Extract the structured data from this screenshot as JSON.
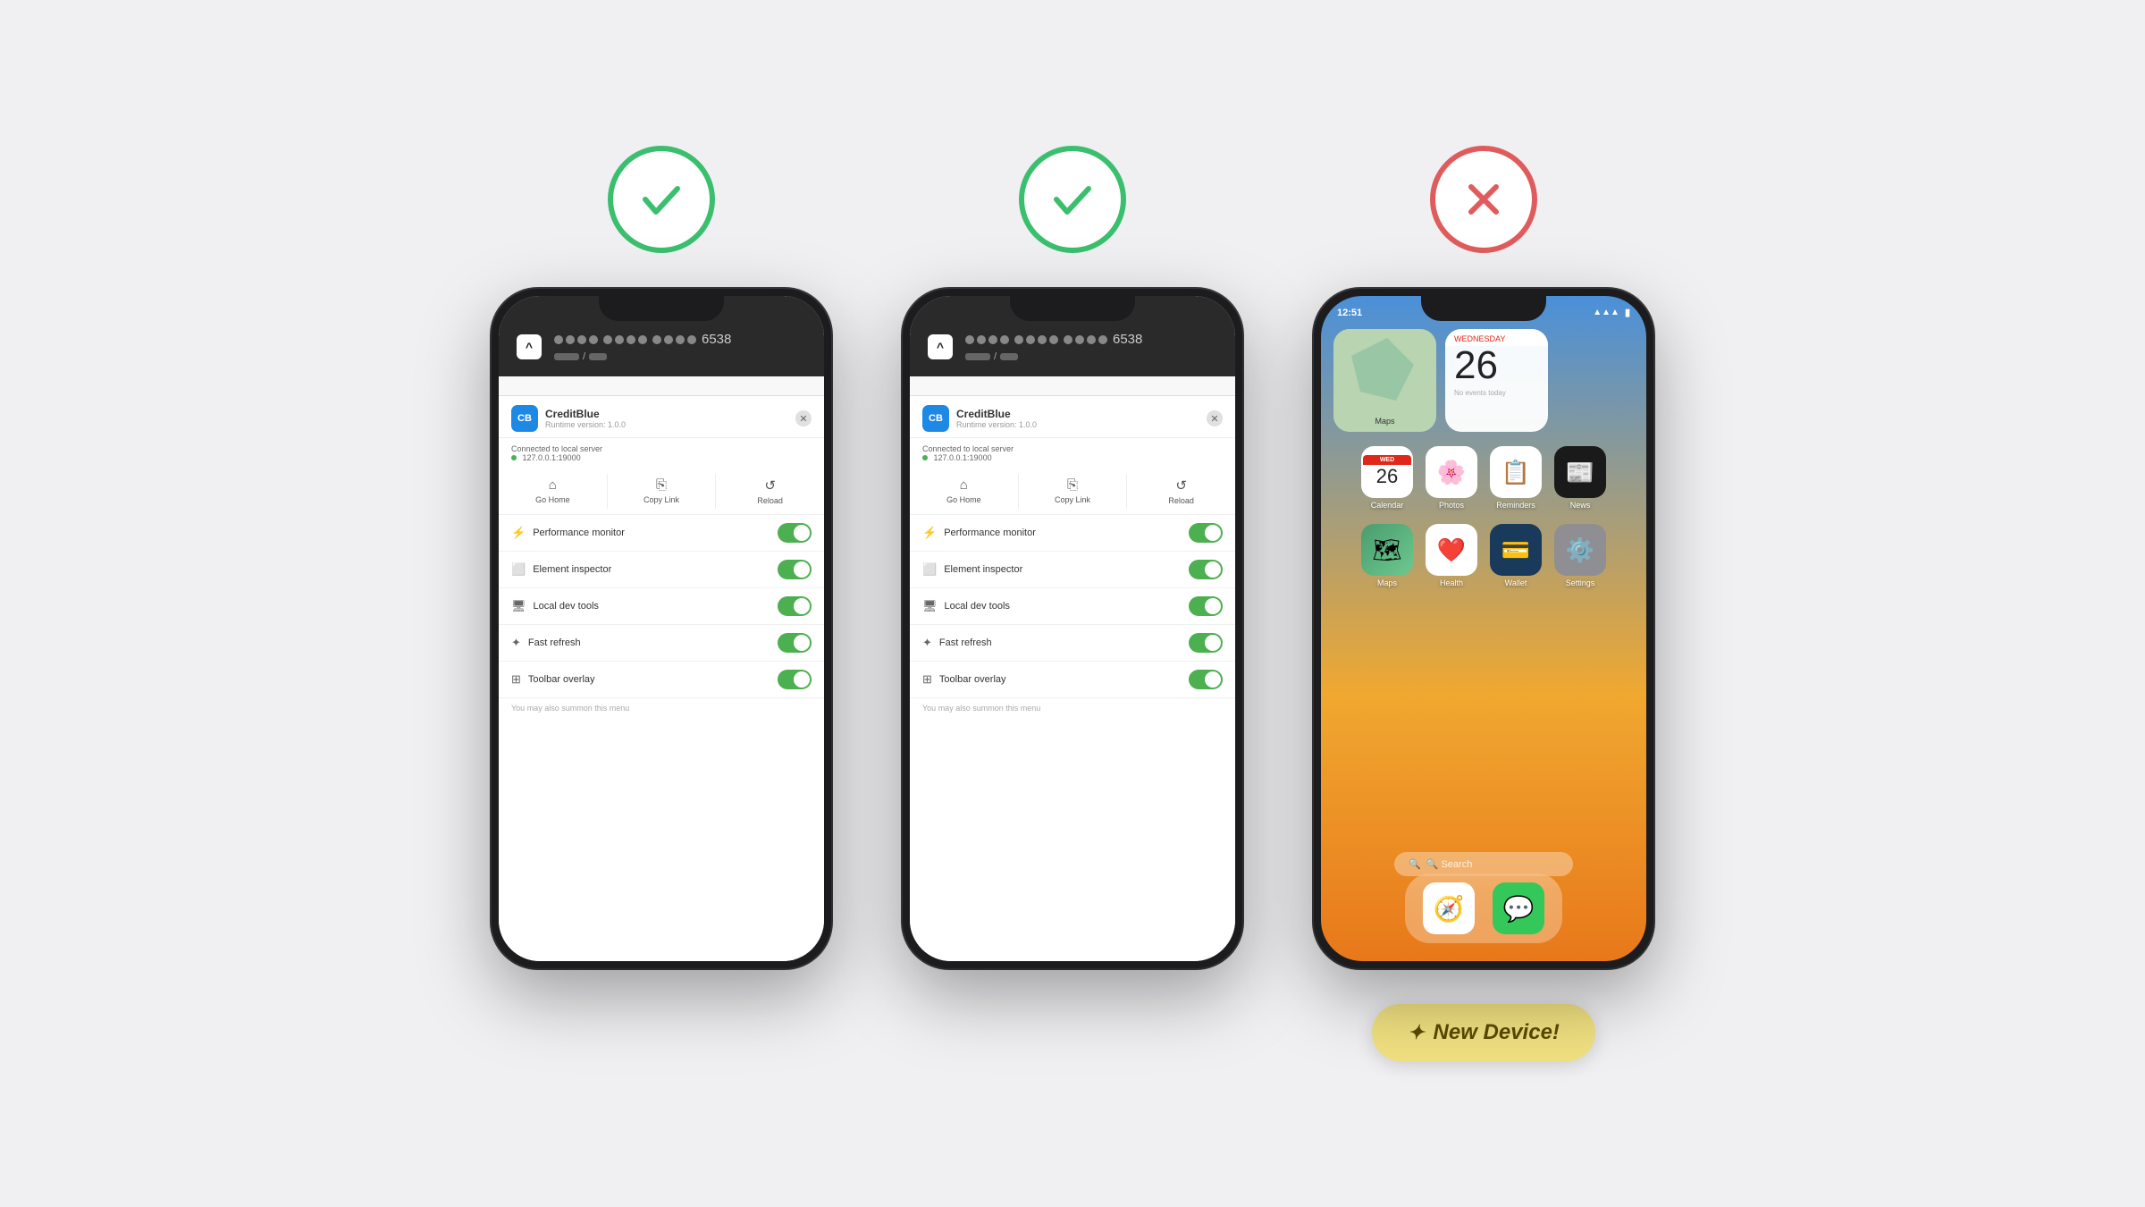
{
  "scene": {
    "background": "#f0f0f2"
  },
  "columns": [
    {
      "id": "col1",
      "status": "check",
      "status_color": "green",
      "phone_type": "dev"
    },
    {
      "id": "col2",
      "status": "check",
      "status_color": "green",
      "phone_type": "dev"
    },
    {
      "id": "col3",
      "status": "cross",
      "status_color": "red",
      "phone_type": "ios"
    }
  ],
  "dev_phone": {
    "card_number_dots": "●●●● ●●●● ●●●●",
    "card_number_real": "6538",
    "app_name": "CreditBlue",
    "app_version": "Runtime version: 1.0.0",
    "server_status": "Connected to local server",
    "server_ip": "127.0.0.1:19000",
    "toolbar": {
      "home_label": "Go Home",
      "copy_label": "Copy Link",
      "reload_label": "Reload"
    },
    "toggles": [
      {
        "label": "Performance monitor",
        "icon": "⚡",
        "on": true
      },
      {
        "label": "Element inspector",
        "icon": "⬜",
        "on": true
      },
      {
        "label": "Local dev tools",
        "icon": "🖥",
        "on": true
      },
      {
        "label": "Fast refresh",
        "icon": "✦",
        "on": true
      },
      {
        "label": "Toolbar overlay",
        "icon": "⊞",
        "on": true
      }
    ],
    "footer_text": "You may also summon this menu"
  },
  "ios_phone": {
    "time": "12:51",
    "calendar_day": "WEDNESDAY",
    "calendar_date": "26",
    "calendar_events": "No events today",
    "app_grid": [
      {
        "label": "Calendar",
        "icon": "📅",
        "bg": "#fff"
      },
      {
        "label": "Photos",
        "icon": "🌸",
        "bg": "#fff"
      },
      {
        "label": "Reminders",
        "icon": "📋",
        "bg": "#fff"
      },
      {
        "label": "News",
        "icon": "📰",
        "bg": "#1a1a1a"
      }
    ],
    "app_grid2": [
      {
        "label": "Maps",
        "icon": "🗺",
        "bg": "#5ab27a"
      },
      {
        "label": "Health",
        "icon": "❤️",
        "bg": "#fff"
      },
      {
        "label": "Wallet",
        "icon": "💳",
        "bg": "#1a3a5c"
      },
      {
        "label": "Settings",
        "icon": "⚙️",
        "bg": "#8e8e93"
      }
    ],
    "search_label": "🔍 Search",
    "dock": [
      {
        "label": "Safari",
        "icon": "🧭",
        "bg": "#fff"
      },
      {
        "label": "Messages",
        "icon": "💬",
        "bg": "#34c759"
      }
    ]
  },
  "new_device_button": {
    "label": "✦ New Device!",
    "sparkle": "✦"
  }
}
